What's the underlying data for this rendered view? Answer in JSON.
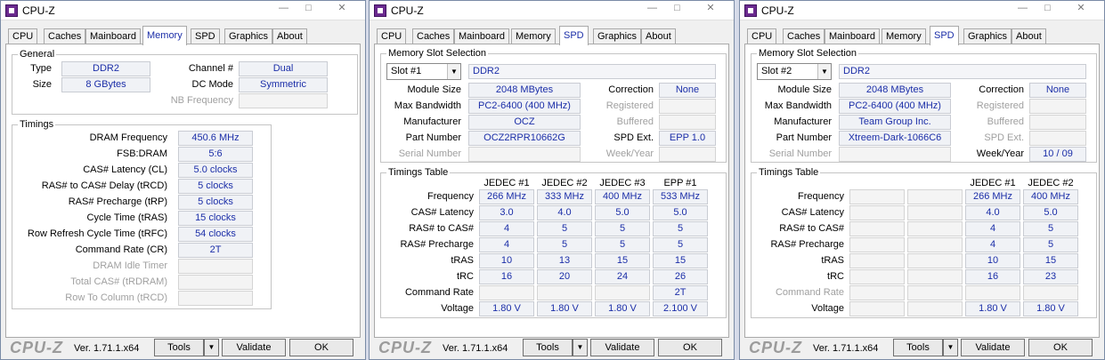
{
  "windows": [
    {
      "title": "CPU-Z",
      "tabs": [
        "CPU",
        "Caches",
        "Mainboard",
        "Memory",
        "SPD",
        "Graphics",
        "About"
      ],
      "active_tab": "Memory",
      "general": {
        "title": "General",
        "type_label": "Type",
        "type_value": "DDR2",
        "size_label": "Size",
        "size_value": "8 GBytes",
        "channel_label": "Channel #",
        "channel_value": "Dual",
        "dcmode_label": "DC Mode",
        "dcmode_value": "Symmetric",
        "nbfreq_label": "NB Frequency",
        "nbfreq_value": ""
      },
      "timings": {
        "title": "Timings",
        "rows": [
          {
            "label": "DRAM Frequency",
            "value": "450.6 MHz"
          },
          {
            "label": "FSB:DRAM",
            "value": "5:6"
          },
          {
            "label": "CAS# Latency (CL)",
            "value": "5.0 clocks"
          },
          {
            "label": "RAS# to CAS# Delay (tRCD)",
            "value": "5 clocks"
          },
          {
            "label": "RAS# Precharge (tRP)",
            "value": "5 clocks"
          },
          {
            "label": "Cycle Time (tRAS)",
            "value": "15 clocks"
          },
          {
            "label": "Row Refresh Cycle Time (tRFC)",
            "value": "54 clocks"
          },
          {
            "label": "Command Rate (CR)",
            "value": "2T"
          },
          {
            "label": "DRAM Idle Timer",
            "value": ""
          },
          {
            "label": "Total CAS# (tRDRAM)",
            "value": ""
          },
          {
            "label": "Row To Column (tRCD)",
            "value": ""
          }
        ]
      },
      "footer": {
        "brand": "CPU-Z",
        "version": "Ver. 1.71.1.x64",
        "tools": "Tools",
        "validate": "Validate",
        "ok": "OK"
      }
    },
    {
      "title": "CPU-Z",
      "tabs": [
        "CPU",
        "Caches",
        "Mainboard",
        "Memory",
        "SPD",
        "Graphics",
        "About"
      ],
      "active_tab": "SPD",
      "slot": {
        "title": "Memory Slot Selection",
        "selected": "Slot #1",
        "type": "DDR2",
        "left": [
          {
            "label": "Module Size",
            "value": "2048 MBytes"
          },
          {
            "label": "Max Bandwidth",
            "value": "PC2-6400 (400 MHz)"
          },
          {
            "label": "Manufacturer",
            "value": "OCZ"
          },
          {
            "label": "Part Number",
            "value": "OCZ2RPR10662G"
          },
          {
            "label": "Serial Number",
            "value": ""
          }
        ],
        "right": [
          {
            "label": "Correction",
            "value": "None"
          },
          {
            "label": "Registered",
            "value": ""
          },
          {
            "label": "Buffered",
            "value": ""
          },
          {
            "label": "SPD Ext.",
            "value": "EPP 1.0"
          },
          {
            "label": "Week/Year",
            "value": ""
          }
        ]
      },
      "timings_table": {
        "title": "Timings Table",
        "columns": [
          "JEDEC #1",
          "JEDEC #2",
          "JEDEC #3",
          "EPP #1"
        ],
        "rows": [
          {
            "label": "Frequency",
            "values": [
              "266 MHz",
              "333 MHz",
              "400 MHz",
              "533 MHz"
            ]
          },
          {
            "label": "CAS# Latency",
            "values": [
              "3.0",
              "4.0",
              "5.0",
              "5.0"
            ]
          },
          {
            "label": "RAS# to CAS#",
            "values": [
              "4",
              "5",
              "5",
              "5"
            ]
          },
          {
            "label": "RAS# Precharge",
            "values": [
              "4",
              "5",
              "5",
              "5"
            ]
          },
          {
            "label": "tRAS",
            "values": [
              "10",
              "13",
              "15",
              "15"
            ]
          },
          {
            "label": "tRC",
            "values": [
              "16",
              "20",
              "24",
              "26"
            ]
          },
          {
            "label": "Command Rate",
            "values": [
              "",
              "",
              "",
              "2T"
            ]
          },
          {
            "label": "Voltage",
            "values": [
              "1.80 V",
              "1.80 V",
              "1.80 V",
              "2.100 V"
            ]
          }
        ]
      },
      "footer": {
        "brand": "CPU-Z",
        "version": "Ver. 1.71.1.x64",
        "tools": "Tools",
        "validate": "Validate",
        "ok": "OK"
      }
    },
    {
      "title": "CPU-Z",
      "tabs": [
        "CPU",
        "Caches",
        "Mainboard",
        "Memory",
        "SPD",
        "Graphics",
        "About"
      ],
      "active_tab": "SPD",
      "slot": {
        "title": "Memory Slot Selection",
        "selected": "Slot #2",
        "type": "DDR2",
        "left": [
          {
            "label": "Module Size",
            "value": "2048 MBytes"
          },
          {
            "label": "Max Bandwidth",
            "value": "PC2-6400 (400 MHz)"
          },
          {
            "label": "Manufacturer",
            "value": "Team Group Inc."
          },
          {
            "label": "Part Number",
            "value": "Xtreem-Dark-1066C6"
          },
          {
            "label": "Serial Number",
            "value": ""
          }
        ],
        "right": [
          {
            "label": "Correction",
            "value": "None"
          },
          {
            "label": "Registered",
            "value": ""
          },
          {
            "label": "Buffered",
            "value": ""
          },
          {
            "label": "SPD Ext.",
            "value": ""
          },
          {
            "label": "Week/Year",
            "value": "10 / 09"
          }
        ]
      },
      "timings_table": {
        "title": "Timings Table",
        "columns": [
          "",
          "",
          "JEDEC #1",
          "JEDEC #2"
        ],
        "rows": [
          {
            "label": "Frequency",
            "values": [
              "",
              "",
              "266 MHz",
              "400 MHz"
            ]
          },
          {
            "label": "CAS# Latency",
            "values": [
              "",
              "",
              "4.0",
              "5.0"
            ]
          },
          {
            "label": "RAS# to CAS#",
            "values": [
              "",
              "",
              "4",
              "5"
            ]
          },
          {
            "label": "RAS# Precharge",
            "values": [
              "",
              "",
              "4",
              "5"
            ]
          },
          {
            "label": "tRAS",
            "values": [
              "",
              "",
              "10",
              "15"
            ]
          },
          {
            "label": "tRC",
            "values": [
              "",
              "",
              "16",
              "23"
            ]
          },
          {
            "label": "Command Rate",
            "values": [
              "",
              "",
              "",
              ""
            ]
          },
          {
            "label": "Voltage",
            "values": [
              "",
              "",
              "1.80 V",
              "1.80 V"
            ]
          }
        ]
      },
      "footer": {
        "brand": "CPU-Z",
        "version": "Ver. 1.71.1.x64",
        "tools": "Tools",
        "validate": "Validate",
        "ok": "OK"
      }
    }
  ]
}
